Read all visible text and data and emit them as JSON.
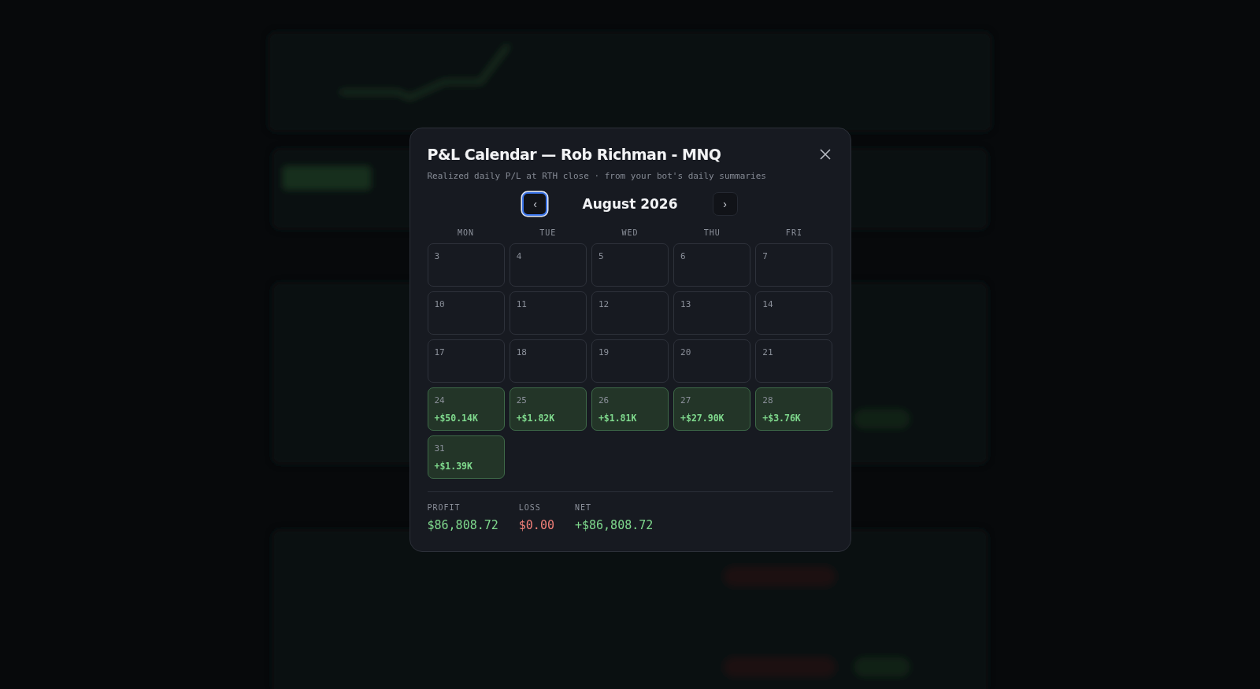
{
  "modal": {
    "title": "P&L Calendar — Rob Richman - MNQ",
    "subtitle": "Realized daily P/L at RTH close · from your bot's daily summaries",
    "nav": {
      "prev": {
        "label": "‹",
        "focused": true
      },
      "month": "August 2026",
      "next": {
        "label": "›",
        "focused": false
      }
    },
    "weekdays": [
      "MON",
      "TUE",
      "WED",
      "THU",
      "FRI"
    ],
    "days": [
      {
        "day": "3",
        "kind": "empty"
      },
      {
        "day": "4",
        "kind": "empty"
      },
      {
        "day": "5",
        "kind": "empty"
      },
      {
        "day": "6",
        "kind": "empty"
      },
      {
        "day": "7",
        "kind": "empty"
      },
      {
        "day": "10",
        "kind": "empty"
      },
      {
        "day": "11",
        "kind": "empty"
      },
      {
        "day": "12",
        "kind": "empty"
      },
      {
        "day": "13",
        "kind": "empty"
      },
      {
        "day": "14",
        "kind": "empty"
      },
      {
        "day": "17",
        "kind": "empty"
      },
      {
        "day": "18",
        "kind": "empty"
      },
      {
        "day": "19",
        "kind": "empty"
      },
      {
        "day": "20",
        "kind": "empty"
      },
      {
        "day": "21",
        "kind": "empty"
      },
      {
        "day": "24",
        "kind": "profit",
        "pnl": "+$50.14K"
      },
      {
        "day": "25",
        "kind": "profit",
        "pnl": "+$1.82K"
      },
      {
        "day": "26",
        "kind": "profit",
        "pnl": "+$1.81K"
      },
      {
        "day": "27",
        "kind": "profit",
        "pnl": "+$27.90K"
      },
      {
        "day": "28",
        "kind": "profit",
        "pnl": "+$3.76K"
      },
      {
        "day": "31",
        "kind": "profit",
        "pnl": "+$1.39K"
      }
    ],
    "totals": [
      {
        "label": "PROFIT",
        "value": "$86,808.72",
        "kind": "profit"
      },
      {
        "label": "LOSS",
        "value": "$0.00",
        "kind": "loss"
      },
      {
        "label": "NET",
        "value": "+$86,808.72",
        "kind": "profit"
      }
    ]
  }
}
